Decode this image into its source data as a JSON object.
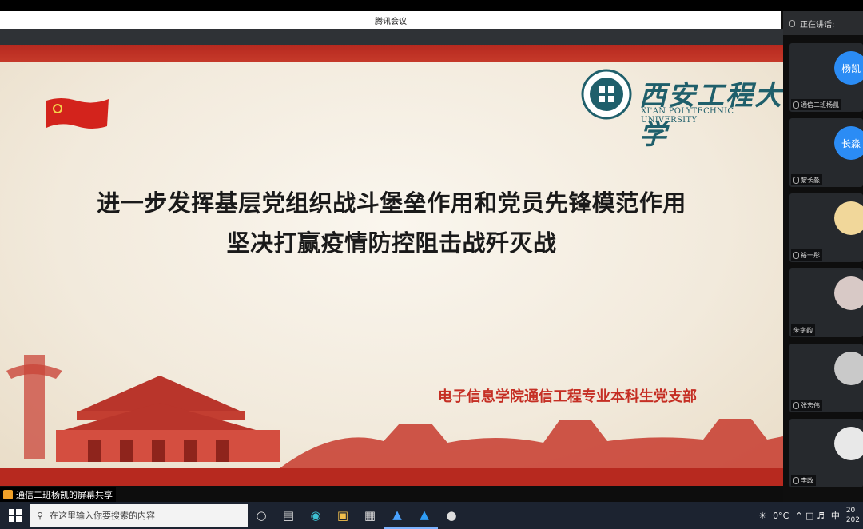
{
  "window": {
    "title": "腾讯会议"
  },
  "slide": {
    "university_cn": "西安工程大学",
    "university_en": "XI'AN POLYTECHNIC UNIVERSITY",
    "heading_line1": "进一步发挥基层党组织战斗堡垒作用和党员先锋模范作用",
    "heading_line2": "坚决打赢疫情防控阻击战歼灭战",
    "department": "电子信息学院通信工程专业本科生党支部"
  },
  "share": {
    "label": "通信二班杨凯的屏幕共享"
  },
  "sidebar": {
    "header": "正在讲话:",
    "participants": [
      {
        "avatar_text": "杨凯",
        "name": "通信二班杨凯",
        "color": "#2b8cf5"
      },
      {
        "avatar_text": "长淼",
        "name": "黎长淼",
        "color": "#2b8cf5"
      },
      {
        "avatar_text": "",
        "name": "裕一彤",
        "color": "#f1d79a"
      },
      {
        "avatar_text": "",
        "name": "朱字韵",
        "color": "#d8c9c6"
      },
      {
        "avatar_text": "",
        "name": "张志伟",
        "color": "#c9c9c9"
      },
      {
        "avatar_text": "",
        "name": "李政",
        "color": "#e8e8e8"
      }
    ]
  },
  "taskbar": {
    "search_placeholder": "在这里输入你要搜索的内容",
    "temperature": "0°C",
    "ime": "中",
    "clock_top": "20",
    "clock_bottom": "202"
  }
}
